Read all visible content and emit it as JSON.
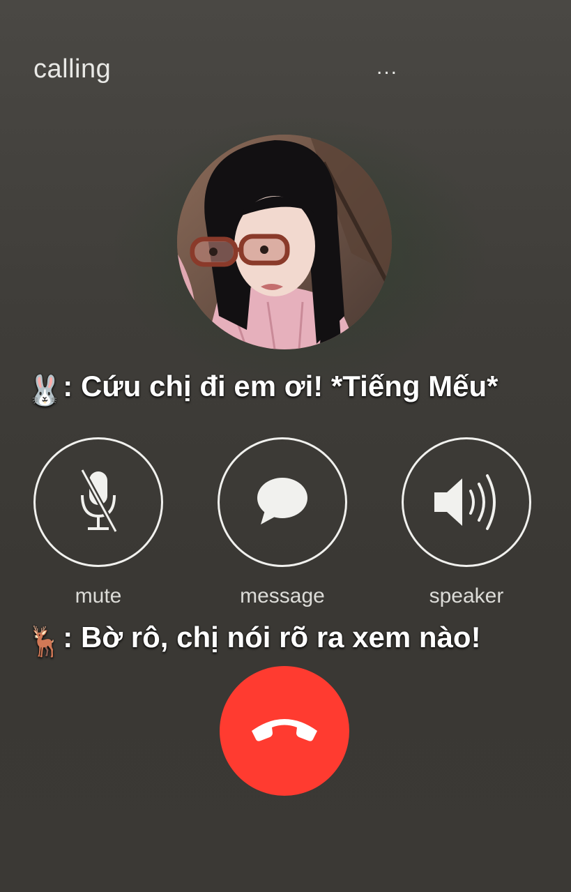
{
  "call": {
    "status": "calling",
    "menu_dots": "...",
    "avatar_icon": "contact-photo"
  },
  "captions": [
    {
      "emoji": "🐰",
      "text": ": Cứu chị đi em ơi! *Tiếng Mếu*"
    },
    {
      "emoji": "🦌",
      "text": ": Bờ rô, chị nói rõ ra xem nào!"
    }
  ],
  "controls": {
    "mute": {
      "label": "mute",
      "icon": "microphone-muted-icon"
    },
    "message": {
      "label": "message",
      "icon": "speech-bubble-icon"
    },
    "speaker": {
      "label": "speaker",
      "icon": "speaker-volume-icon"
    }
  },
  "end_call": {
    "icon": "phone-hangup-icon"
  },
  "colors": {
    "background": "#3e3c38",
    "end_call_red": "#ff3b30",
    "text_light": "#e9e9e6"
  }
}
